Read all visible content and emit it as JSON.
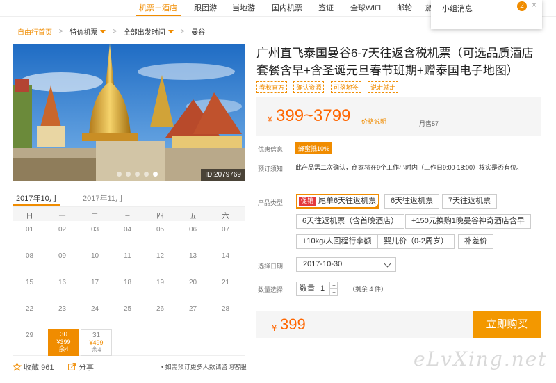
{
  "nav": {
    "items": [
      "机票＋酒店",
      "跟团游",
      "当地游",
      "国内机票",
      "签证",
      "全球WiFi",
      "邮轮",
      "旅"
    ],
    "active_index": 0,
    "accent_color": "#f08c00"
  },
  "notice": {
    "label": "小组消息",
    "count": "2",
    "close": "×"
  },
  "breadcrumb": {
    "home": "自由行首页",
    "items": [
      "特价机票",
      "全部出发时间",
      "曼谷"
    ],
    "separator": ">"
  },
  "gallery": {
    "id_label": "ID:2079769",
    "slide_count": 5,
    "active_slide": 4
  },
  "calendar": {
    "tabs": [
      "2017年10月",
      "2017年11月"
    ],
    "weekdays": [
      "日",
      "一",
      "二",
      "三",
      "四",
      "五",
      "六"
    ],
    "rows": [
      [
        "01",
        "02",
        "03",
        "04",
        "05",
        "06",
        "07"
      ],
      [
        "08",
        "09",
        "10",
        "11",
        "12",
        "13",
        "14"
      ],
      [
        "15",
        "16",
        "17",
        "18",
        "19",
        "20",
        "21"
      ],
      [
        "22",
        "23",
        "24",
        "25",
        "26",
        "27",
        "28"
      ],
      [
        "29"
      ]
    ],
    "cells": [
      {
        "day": "30",
        "price": "¥399",
        "remain": "余4"
      },
      {
        "day": "31",
        "price": "¥499",
        "remain": "余4"
      }
    ]
  },
  "social": {
    "fav_label": "收藏",
    "fav_count": "961",
    "share_label": "分享",
    "hint": "• 如需预订更多人数请咨询客服"
  },
  "product": {
    "title": "广州直飞泰国曼谷6-7天往返含税机票（可选品质酒店套餐含早+含圣诞元旦春节班期+赠泰国电子地图）",
    "tags": [
      "春秋官方",
      "确认资源",
      "可落地签",
      "说走就走"
    ],
    "currency": "¥",
    "price_range": "399~3799",
    "price_note": "价格说明",
    "sold": "月售57"
  },
  "info": {
    "promo_label": "优惠信息",
    "promo_badge": "蜂蜜抵10%",
    "notice_label": "预订须知",
    "notice_text": "此产品需二次确认，商家将在9个工作小时内（工作日9:00-18:00）核实是否有位。"
  },
  "type_select": {
    "label": "产品类型",
    "hot_badge": "促销",
    "options": [
      "尾单6天往返机票",
      "6天往返机票",
      "7天往返机票",
      "6天往返机票（含首晚酒店）",
      "+150元换购1晚曼谷神奇酒店含早",
      "+10kg/人回程行李额",
      "婴儿价（0-2周岁）",
      "补差价"
    ],
    "selected_index": 0
  },
  "date_select": {
    "label": "选择日期",
    "value": "2017-10-30"
  },
  "quantity": {
    "label": "数量选择",
    "field_label": "数量",
    "value": "1",
    "plus": "+",
    "minus": "−",
    "remain": "（剩余 4 件）"
  },
  "buy": {
    "currency": "¥",
    "price": "399",
    "button": "立即购买"
  },
  "watermark": "eLvXing.net"
}
